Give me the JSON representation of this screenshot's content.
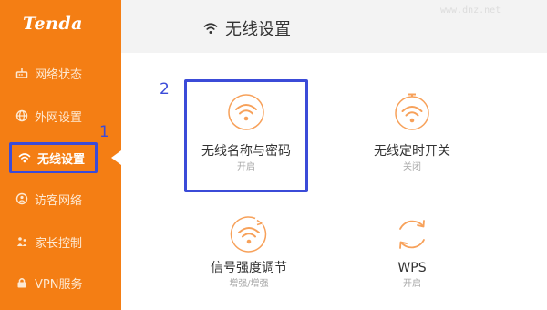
{
  "brand": {
    "logo_text": "Tenda",
    "accent": "#f47e14",
    "highlight": "#3b4bd8"
  },
  "watermark": "www.dnz.net",
  "header": {
    "title": "无线设置",
    "icon": "wifi-icon"
  },
  "annotations": {
    "step1": "1",
    "step2": "2"
  },
  "sidebar": {
    "items": [
      {
        "label": "网络状态",
        "icon": "network-status-icon",
        "active": false
      },
      {
        "label": "外网设置",
        "icon": "globe-icon",
        "active": false
      },
      {
        "label": "无线设置",
        "icon": "wifi-icon",
        "active": true
      },
      {
        "label": "访客网络",
        "icon": "guest-network-icon",
        "active": false
      },
      {
        "label": "家长控制",
        "icon": "parental-control-icon",
        "active": false
      },
      {
        "label": "VPN服务",
        "icon": "vpn-lock-icon",
        "active": false
      }
    ]
  },
  "tiles": [
    {
      "label": "无线名称与密码",
      "status": "开启",
      "icon": "wifi-circle-icon"
    },
    {
      "label": "无线定时开关",
      "status": "关闭",
      "icon": "wifi-timer-icon"
    },
    {
      "label": "信号强度调节",
      "status": "增强/增强",
      "icon": "wifi-signal-strength-icon"
    },
    {
      "label": "WPS",
      "status": "开启",
      "icon": "wps-refresh-icon"
    }
  ]
}
